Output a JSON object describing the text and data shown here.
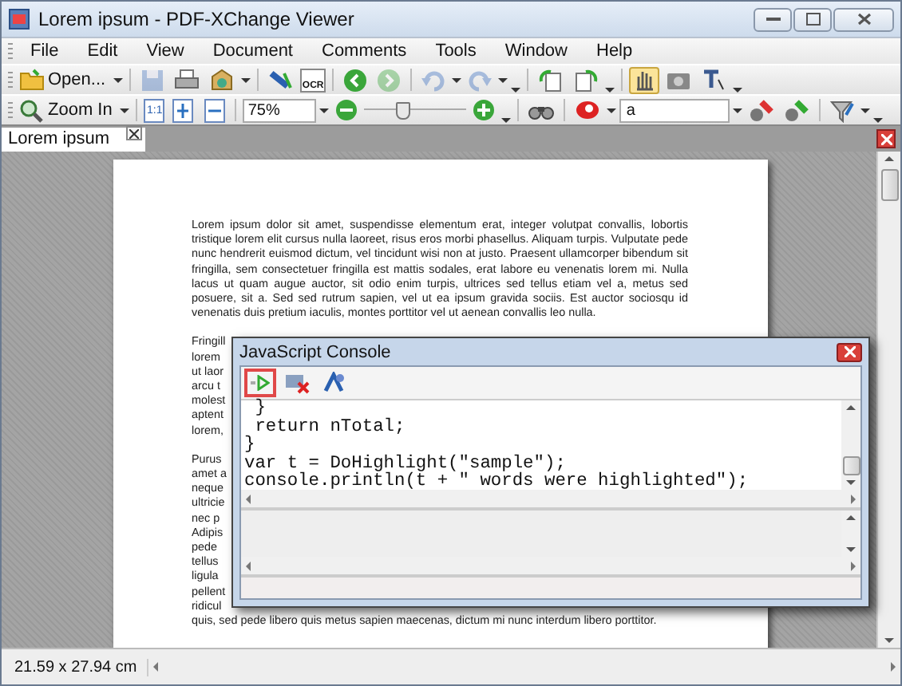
{
  "window": {
    "title": "Lorem ipsum - PDF-XChange Viewer"
  },
  "menu": [
    "File",
    "Edit",
    "View",
    "Document",
    "Comments",
    "Tools",
    "Window",
    "Help"
  ],
  "toolbar_1": {
    "open": {
      "label": "Open..."
    },
    "save": {
      "disabled": true
    },
    "ocr": {
      "label": "OCR"
    },
    "forward": {
      "disabled": true
    },
    "undo": {
      "disabled": true
    },
    "redo": {
      "disabled": true
    },
    "tools": [
      {
        "selected": true
      },
      {
        "selected": false
      },
      {
        "selected": false
      }
    ]
  },
  "toolbar_2": {
    "zoom": {
      "label": "Zoom In"
    },
    "actual_size": {
      "label": "1:1"
    },
    "zoom_value": "75%",
    "zoom_slider": {
      "level": 0.35
    },
    "search": {
      "value": "a"
    }
  },
  "tabs": [
    {
      "label": "Lorem ipsum",
      "selected": true
    }
  ],
  "page": {
    "paragraph": "Lorem ipsum dolor sit amet, suspendisse elementum erat, integer volutpat convallis, lobortis tristique lorem elit cursus nulla laoreet, risus eros morbi phasellus. Aliquam turpis. Vulputate pede nunc hendrerit euismod dictum, vel tincidunt wisi non at justo. Praesent ullamcorper bibendum sit fringilla, sem consectetuer fringilla est mattis sodales, erat labore eu venenatis lorem mi. Nulla lacus ut quam augue auctor, sit odio enim turpis, ultrices sed tellus etiam vel a, metus sed posuere, sit a. Sed sed rutrum sapien, vel ut ea ipsum gravida sociis. Est auctor sociosqu id venenatis duis pretium iaculis, montes porttitor vel ut aenean convallis leo nulla.",
    "fragments_1": [
      "Fringill",
      "lorem",
      "ut laor",
      "arcu t",
      "molest",
      "aptent",
      "lorem,"
    ],
    "fragments_2": [
      "Purus",
      "amet a",
      "neque",
      "ultricie",
      "nec p",
      "Adipis",
      "pede",
      "tellus",
      "ligula",
      "pellent",
      "ridicul"
    ],
    "last_line": "quis, sed pede libero quis metus sapien maecenas, dictum mi nunc interdum libero porttitor."
  },
  "console": {
    "title": "JavaScript Console",
    "run": {
      "highlighted": true
    },
    "code": [
      " }",
      " return nTotal;",
      "}",
      "var t = DoHighlight(\"sample\");",
      "console.println(t + \" words were highlighted\");"
    ]
  },
  "status_bar": {
    "page_size": "21.59 x 27.94 cm"
  }
}
